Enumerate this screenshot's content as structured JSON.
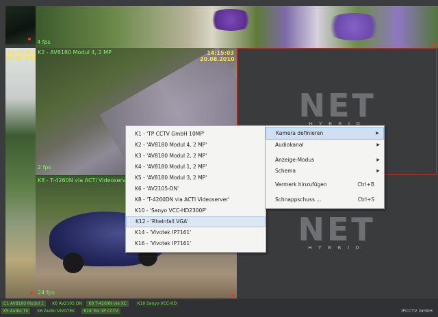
{
  "cameras": {
    "top_left": {
      "time": "14:15:03",
      "date": "09.08.2010"
    },
    "center": {
      "label": "K2 - AV8180 Modul 4, 2 MP",
      "time": "14:15:03",
      "date": "20.08.2010",
      "overlay": "2 fps"
    },
    "bottom": {
      "label": "K8 - T-4260N via ACTi Videoserver",
      "overlay": "24 fps"
    },
    "strip": {
      "label": "4 fps"
    }
  },
  "logo": {
    "text": "NET",
    "subtext": "HYBRID"
  },
  "camera_menu": [
    "K1 - 'TP CCTV GmbH 10MP'",
    "K2 - 'AV8180 Modul 4, 2 MP'",
    "K3 - 'AV8180 Modul 2, 2 MP'",
    "K4 - 'AV8180 Modul 1, 2 MP'",
    "K5 - 'AV8180 Modul 3, 2 MP'",
    "K6 - 'AV2105-DN'",
    "K8 - 'T-4260DN via ACTI Videoserver'",
    "K10 - 'Sanyo VCC-HD2300P'",
    "K12 - 'Rheinfall VGA'",
    "K14 - 'Vivotek IP7161'",
    "K16 - 'Vivotek IP7161'"
  ],
  "camera_menu_selected": 8,
  "context_menu": [
    {
      "label": "Kamera definieren",
      "shortcut": "",
      "submenu": true
    },
    {
      "label": "Audiokanal",
      "shortcut": "",
      "submenu": true
    },
    {
      "label": "Anzeige-Modus",
      "shortcut": "",
      "submenu": true
    },
    {
      "label": "Schema",
      "shortcut": "",
      "submenu": true
    },
    {
      "label": "Vermerk hinzufügen",
      "shortcut": "Ctrl+B",
      "submenu": false
    },
    {
      "label": "Schnappschuss ...",
      "shortcut": "Ctrl+S",
      "submenu": false
    }
  ],
  "status_bar": {
    "tabs_row1": [
      "C1 AV8180 Modul 1",
      "K6 AV2105 DN",
      "K8 T-4260N via XC",
      "K10 Sanyo VCC-HD"
    ],
    "tabs_row2": [
      "K5 Audio TV",
      "K6 Audio VIVOTEK",
      "K18 Tox 1P CCTV"
    ],
    "company": "IPCCTV GmbH"
  },
  "colors": {
    "accent_green": "#7cfc6a",
    "timestamp_yellow": "#ffe23a",
    "active_border": "#c0302a"
  }
}
